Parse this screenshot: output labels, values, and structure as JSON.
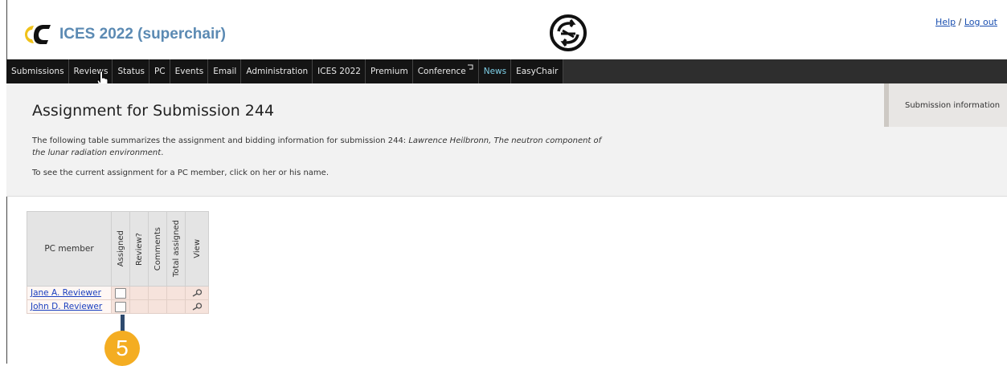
{
  "header": {
    "app_title": "ICES 2022 (superchair)",
    "help_label": "Help",
    "separator": " / ",
    "logout_label": "Log out"
  },
  "menu": {
    "items": [
      {
        "label": "Submissions"
      },
      {
        "label": "Reviews"
      },
      {
        "label": "Status"
      },
      {
        "label": "PC"
      },
      {
        "label": "Events"
      },
      {
        "label": "Email"
      },
      {
        "label": "Administration"
      },
      {
        "label": "ICES 2022"
      },
      {
        "label": "Premium"
      },
      {
        "label": "Conference"
      },
      {
        "label": "News"
      },
      {
        "label": "EasyChair"
      }
    ]
  },
  "page": {
    "heading": "Assignment for Submission 244",
    "intro_prefix": "The following table summarizes the assignment and bidding information for submission 244: ",
    "intro_italic": "Lawrence Heilbronn, The neutron component of the lunar radiation environment",
    "intro_suffix": ".",
    "hint": "To see the current assignment for a PC member, click on her or his name.",
    "side_link": "Submission information"
  },
  "table": {
    "columns": [
      "PC member",
      "Assigned",
      "Review?",
      "Comments",
      "Total assigned",
      "View"
    ],
    "rows": [
      {
        "member": "Jane A. Reviewer",
        "assigned": false,
        "review": "",
        "comments": "",
        "total": ""
      },
      {
        "member": "John D. Reviewer",
        "assigned": false,
        "review": "",
        "comments": "",
        "total": ""
      }
    ]
  },
  "callout": {
    "number": "5"
  },
  "colors": {
    "menu_bg": "#141414",
    "news_text": "#7fd0e8",
    "title_blue": "#5b8ab3",
    "callout_orange": "#f4ad22",
    "link_blue": "#1a3fbf"
  },
  "icons": {
    "logo": "easychair-logo",
    "badge": "recycle-badge-icon",
    "cursor": "hand-pointer-icon",
    "view": "magnifier-icon",
    "conference_menu": "return-arrow-icon"
  }
}
